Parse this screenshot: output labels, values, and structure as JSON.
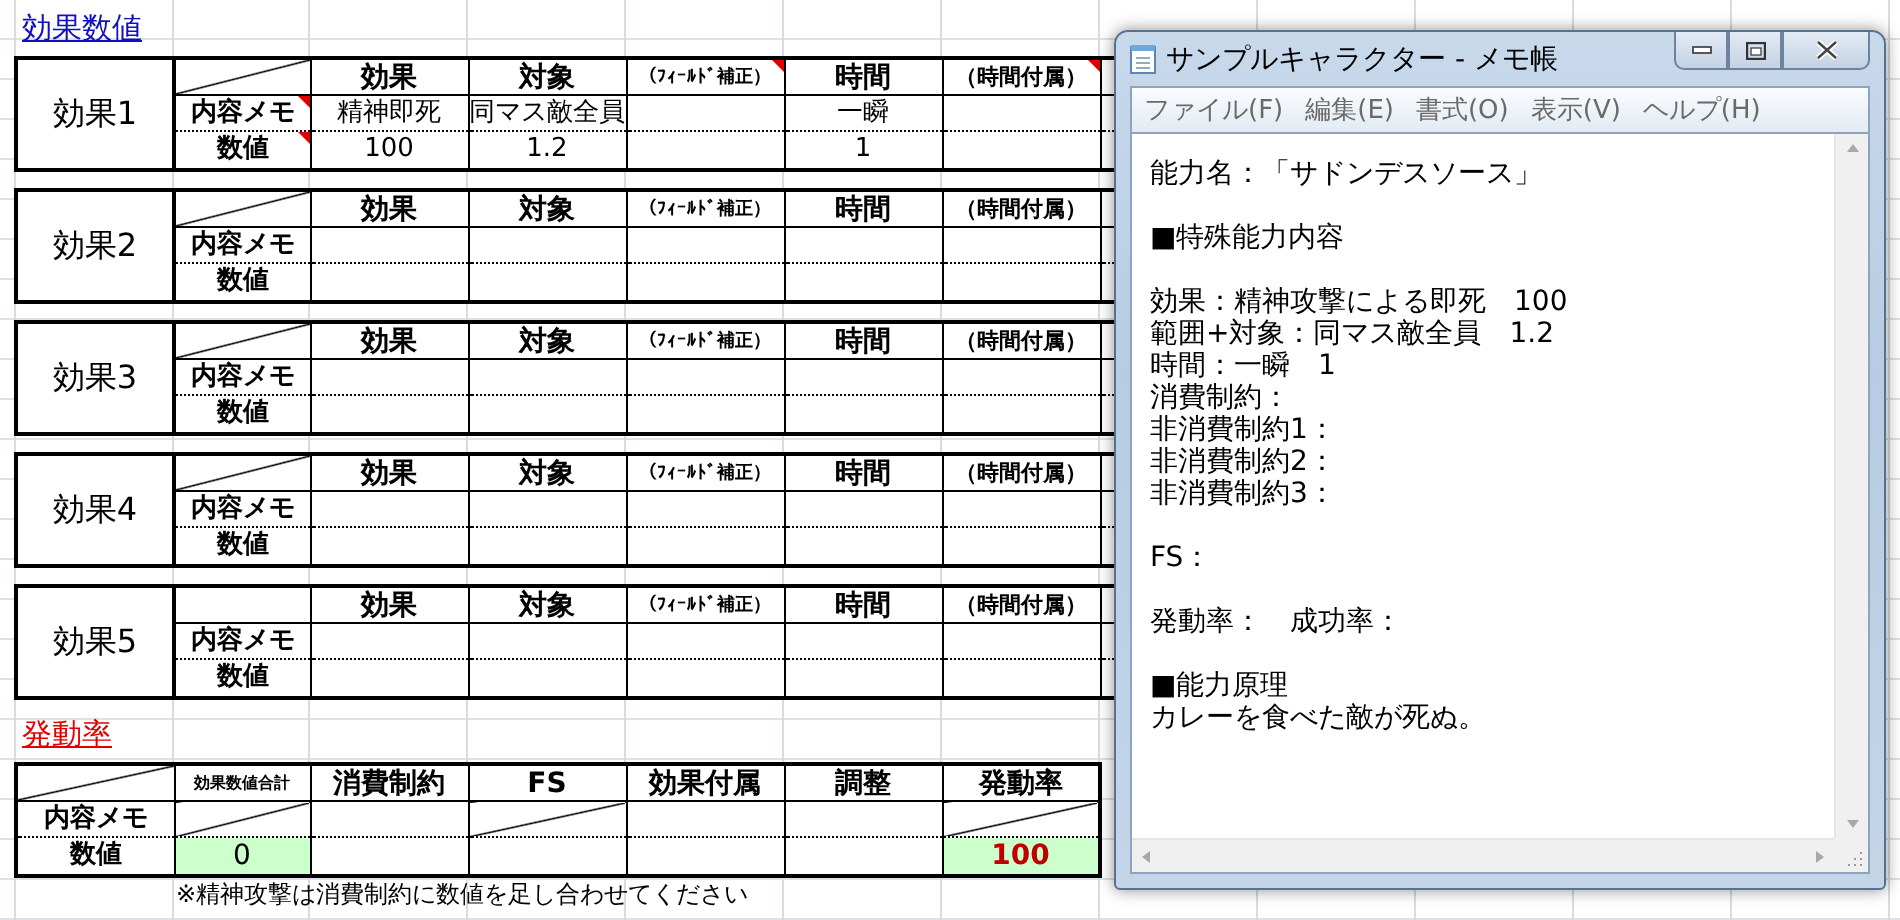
{
  "sheet": {
    "effects_title": "効果数値",
    "effects": [
      {
        "label": "効果1",
        "diagonal": true,
        "commented": true,
        "row_labels": [
          "内容メモ",
          "数値"
        ],
        "columns": [
          {
            "text": "効果",
            "kind": "normal",
            "memo": "精神即死",
            "value": "100"
          },
          {
            "text": "対象",
            "kind": "normal",
            "memo": "同マス敵全員",
            "value": "1.2"
          },
          {
            "text": "（ﾌｨｰﾙﾄﾞ補正）",
            "kind": "small"
          },
          {
            "text": "時間",
            "kind": "normal",
            "memo": "一瞬",
            "value": "1"
          },
          {
            "text": "（時間付属）",
            "kind": "medium"
          }
        ]
      },
      {
        "label": "効果2",
        "diagonal": true,
        "commented": false,
        "row_labels": [
          "内容メモ",
          "数値"
        ],
        "columns": [
          {
            "text": "効果",
            "kind": "normal"
          },
          {
            "text": "対象",
            "kind": "normal"
          },
          {
            "text": "（ﾌｨｰﾙﾄﾞ補正）",
            "kind": "small"
          },
          {
            "text": "時間",
            "kind": "normal"
          },
          {
            "text": "（時間付属）",
            "kind": "medium"
          }
        ]
      },
      {
        "label": "効果3",
        "diagonal": true,
        "commented": false,
        "row_labels": [
          "内容メモ",
          "数値"
        ],
        "columns": [
          {
            "text": "効果",
            "kind": "normal"
          },
          {
            "text": "対象",
            "kind": "normal"
          },
          {
            "text": "（ﾌｨｰﾙﾄﾞ補正）",
            "kind": "small"
          },
          {
            "text": "時間",
            "kind": "normal"
          },
          {
            "text": "（時間付属）",
            "kind": "medium"
          }
        ]
      },
      {
        "label": "効果4",
        "diagonal": true,
        "commented": false,
        "row_labels": [
          "内容メモ",
          "数値"
        ],
        "columns": [
          {
            "text": "効果",
            "kind": "normal"
          },
          {
            "text": "対象",
            "kind": "normal"
          },
          {
            "text": "（ﾌｨｰﾙﾄﾞ補正）",
            "kind": "small"
          },
          {
            "text": "時間",
            "kind": "normal"
          },
          {
            "text": "（時間付属）",
            "kind": "medium"
          }
        ]
      },
      {
        "label": "効果5",
        "diagonal": false,
        "commented": false,
        "row_labels": [
          "内容メモ",
          "数値"
        ],
        "columns": [
          {
            "text": "効果",
            "kind": "normal"
          },
          {
            "text": "対象",
            "kind": "normal"
          },
          {
            "text": "（ﾌｨｰﾙﾄﾞ補正）",
            "kind": "small"
          },
          {
            "text": "時間",
            "kind": "normal"
          },
          {
            "text": "（時間付属）",
            "kind": "medium"
          }
        ]
      }
    ],
    "rate": {
      "title": "発動率",
      "row_labels": [
        "内容メモ",
        "数値"
      ],
      "columns": [
        {
          "header": "効果数値合計",
          "kind": "small",
          "memo_blocked": true,
          "value": "0",
          "highlighted": true,
          "color": "#000000"
        },
        {
          "header": "消費制約",
          "kind": "normal",
          "memo_blocked": false,
          "highlighted": false
        },
        {
          "header": "FS",
          "kind": "normal",
          "memo_blocked": true,
          "highlighted": false
        },
        {
          "header": "効果付属",
          "kind": "normal",
          "memo_blocked": false,
          "highlighted": false
        },
        {
          "header": "調整",
          "kind": "normal",
          "memo_blocked": false,
          "highlighted": false
        },
        {
          "header": "発動率",
          "kind": "normal",
          "memo_blocked": true,
          "value": "100",
          "highlighted": true,
          "color": "#c00000"
        }
      ],
      "note": "※精神攻撃は消費制約に数値を足し合わせてください"
    }
  },
  "notepad": {
    "title": "サンプルキャラクター - メモ帳",
    "menu": [
      "ファイル(F)",
      "編集(E)",
      "書式(O)",
      "表示(V)",
      "ヘルプ(H)"
    ],
    "paragraphs": [
      [
        "能力名：「サドンデスソース」"
      ],
      [
        "■特殊能力内容"
      ],
      [
        "効果：精神攻撃による即死　100",
        "範囲+対象：同マス敵全員　1.2",
        "時間：一瞬　1",
        "消費制約：",
        "非消費制約1：",
        "非消費制約2：",
        "非消費制約3："
      ],
      [
        "FS："
      ],
      [
        "発動率：　成功率："
      ],
      [
        "■能力原理",
        "カレーを食べた敵が死ぬ。"
      ]
    ]
  }
}
